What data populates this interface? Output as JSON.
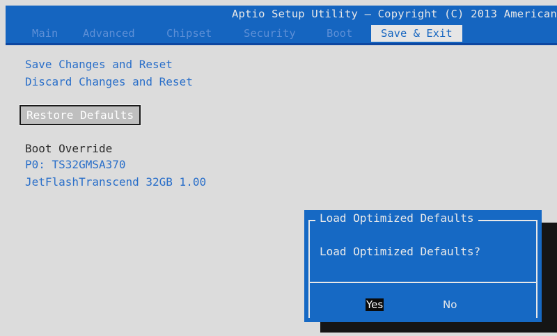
{
  "header": {
    "title": "Aptio Setup Utility – Copyright (C) 2013 American"
  },
  "tabs": [
    {
      "label": "Main"
    },
    {
      "label": "Advanced"
    },
    {
      "label": "Chipset"
    },
    {
      "label": "Security"
    },
    {
      "label": "Boot"
    },
    {
      "label": "Save & Exit",
      "active": true
    }
  ],
  "menu": {
    "save_reset": "Save Changes and Reset",
    "discard_reset": "Discard Changes and Reset",
    "restore_defaults": "Restore Defaults",
    "boot_override": "Boot Override",
    "boot_devices": [
      "P0: TS32GMSA370",
      "JetFlashTranscend 32GB 1.00"
    ]
  },
  "dialog": {
    "title": "Load Optimized Defaults",
    "message": "Load Optimized Defaults?",
    "yes_label": "Yes",
    "no_label": "No"
  },
  "colors": {
    "accent": "#1565c0",
    "menu_link": "#2a6fc9",
    "background": "#dcdcdc"
  }
}
